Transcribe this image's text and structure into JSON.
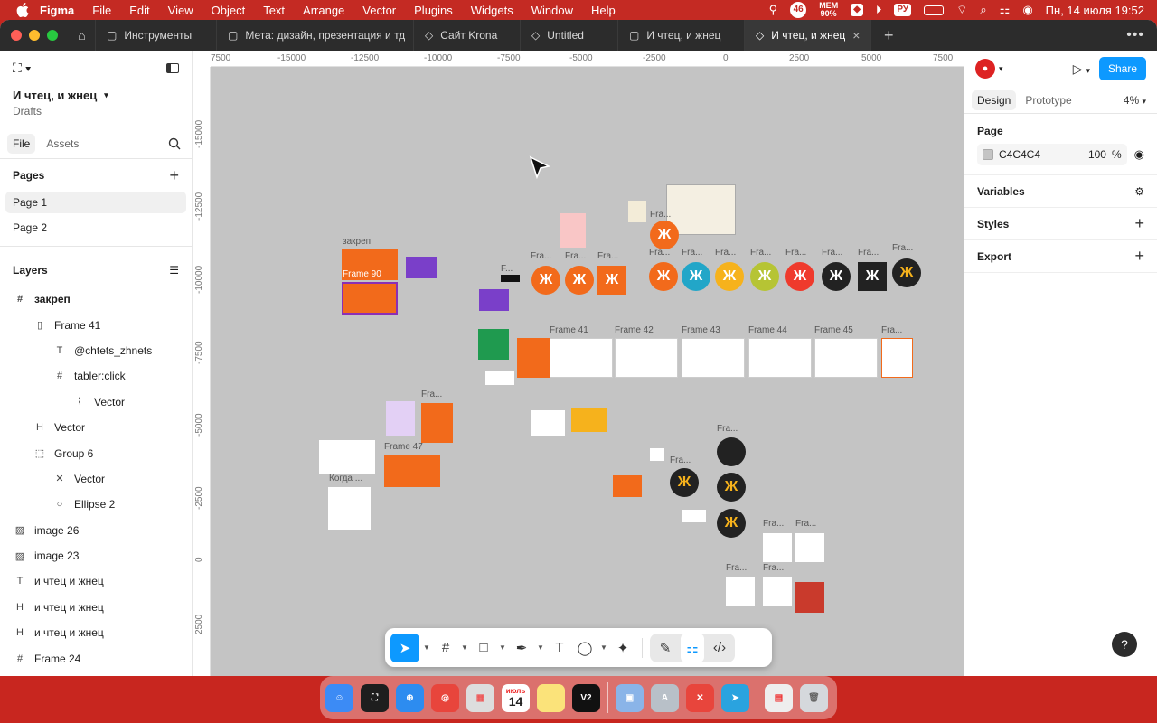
{
  "menubar": {
    "app": "Figma",
    "items": [
      "File",
      "Edit",
      "View",
      "Object",
      "Text",
      "Arrange",
      "Vector",
      "Plugins",
      "Widgets",
      "Window",
      "Help"
    ],
    "badge_count": "46",
    "mem_label": "MEM",
    "mem_value": "90%",
    "input_lang": "РУ",
    "datetime": "Пн, 14 июля  19:52"
  },
  "tabs": [
    {
      "label": "Инструменты"
    },
    {
      "label": "Мета: дизайн, презентация и тд"
    },
    {
      "label": "Сайт Krona"
    },
    {
      "label": "Untitled"
    },
    {
      "label": "И чтец, и жнец"
    },
    {
      "label": "И чтец, и жнец",
      "active": true
    }
  ],
  "file": {
    "name": "И чтец, и жнец",
    "location": "Drafts"
  },
  "left_tabs": {
    "file": "File",
    "assets": "Assets"
  },
  "pages": {
    "title": "Pages",
    "items": [
      "Page 1",
      "Page 2"
    ]
  },
  "layers": {
    "title": "Layers",
    "items": [
      {
        "label": "закреп",
        "icon": "#",
        "indent": 0,
        "bold": true
      },
      {
        "label": "Frame 41",
        "icon": "▯",
        "indent": 1
      },
      {
        "label": "@chtets_zhnets",
        "icon": "T",
        "indent": 2
      },
      {
        "label": "tabler:click",
        "icon": "#",
        "indent": 2
      },
      {
        "label": "Vector",
        "icon": "⌇",
        "indent": 3
      },
      {
        "label": "Vector",
        "icon": "H",
        "indent": 1
      },
      {
        "label": "Group 6",
        "icon": "⬚",
        "indent": 1
      },
      {
        "label": "Vector",
        "icon": "✕",
        "indent": 2
      },
      {
        "label": "Ellipse 2",
        "icon": "○",
        "indent": 2
      },
      {
        "label": "image 26",
        "icon": "▨",
        "indent": 0
      },
      {
        "label": "image 23",
        "icon": "▨",
        "indent": 0
      },
      {
        "label": "и чтец и жнец",
        "icon": "T",
        "indent": 0
      },
      {
        "label": "и чтец и жнец",
        "icon": "H",
        "indent": 0
      },
      {
        "label": "и чтец и жнец",
        "icon": "H",
        "indent": 0
      },
      {
        "label": "Frame 24",
        "icon": "#",
        "indent": 0
      }
    ]
  },
  "ruler": {
    "x": [
      "7500",
      "-15000",
      "-12500",
      "-10000",
      "-7500",
      "-5000",
      "-2500",
      "0",
      "2500",
      "5000",
      "7500"
    ],
    "y": [
      "-15000",
      "-12500",
      "-10000",
      "-7500",
      "-5000",
      "-2500",
      "0",
      "2500"
    ]
  },
  "canvas": {
    "glyph": "Ж",
    "labels": {
      "zakrep": "закреп",
      "frame90": "Frame 90",
      "frame41": "Frame 41",
      "frame42": "Frame 42",
      "frame43": "Frame 43",
      "frame44": "Frame 44",
      "frame45": "Frame 45",
      "frame47": "Frame 47",
      "kogda": "Когда ...",
      "fra": "Fra...",
      "f": "F..."
    }
  },
  "right": {
    "share": "Share",
    "design": "Design",
    "prototype": "Prototype",
    "zoom": "4%",
    "page_title": "Page",
    "bg_hex": "C4C4C4",
    "bg_opacity": "100",
    "pct": "%",
    "variables": "Variables",
    "styles": "Styles",
    "export": "Export"
  },
  "help": "?",
  "dock": {
    "calendar_month": "июль",
    "calendar_day": "14",
    "v2": "V2"
  },
  "colors": {
    "menubar": "#c42a23",
    "accent": "#0d99ff",
    "orange": "#f26a1b",
    "canvas": "#c4c4c4"
  }
}
